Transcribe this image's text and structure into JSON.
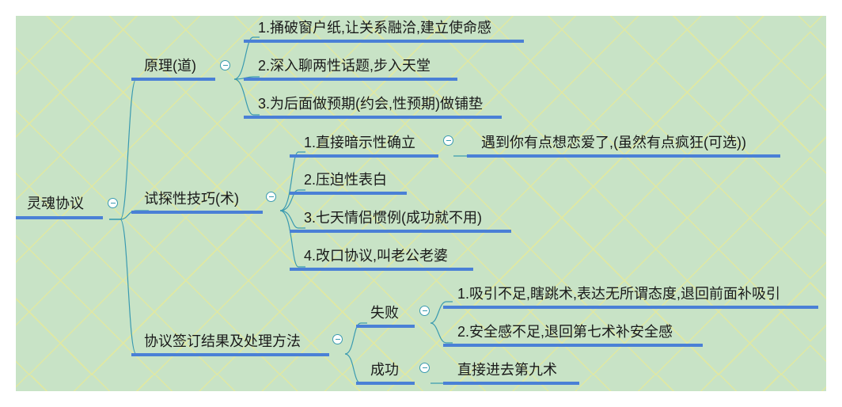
{
  "root": {
    "label": "灵魂协议"
  },
  "branches": [
    {
      "label": "原理(道)",
      "children": [
        "1.捅破窗户纸,让关系融洽,建立使命感",
        "2.深入聊两性话题,步入天堂",
        "3.为后面做预期(约会,性预期)做铺垫"
      ]
    },
    {
      "label": "试探性技巧(术)",
      "children": [
        {
          "label": "1.直接暗示性确立",
          "child": "遇到你有点想恋爱了,(虽然有点疯狂(可选))"
        },
        "2.压迫性表白",
        "3.七天情侣惯例(成功就不用)",
        "4.改口协议,叫老公老婆"
      ]
    },
    {
      "label": "协议签订结果及处理方法",
      "children": [
        {
          "label": "失败",
          "children": [
            "1.吸引不足,瞎跳术,表达无所谓态度,退回前面补吸引",
            "2.安全感不足,退回第七术补安全感"
          ]
        },
        {
          "label": "成功",
          "child": "直接进去第九术"
        }
      ]
    }
  ],
  "colors": {
    "connector": "#3a9ab0",
    "underline": "#4a80d6",
    "background": "#c8e3c6"
  }
}
